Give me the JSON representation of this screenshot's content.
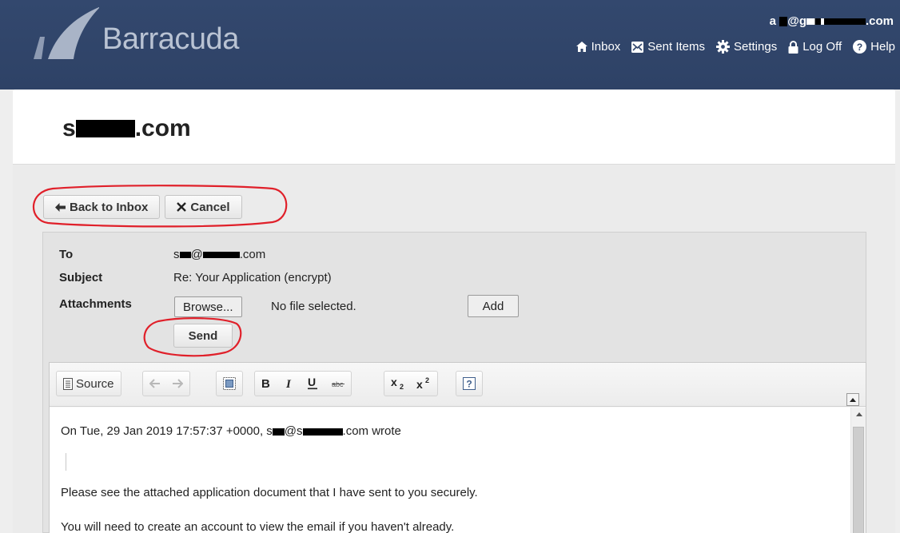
{
  "brand": {
    "name": "Barracuda"
  },
  "user": {
    "email_prefix": "a",
    "email_mid": "@g",
    "email_suffix": ".com"
  },
  "nav": {
    "inbox": "Inbox",
    "sent_items": "Sent Items",
    "settings": "Settings",
    "log_off": "Log Off",
    "help": "Help"
  },
  "page": {
    "title_prefix": "s",
    "title_suffix": ".com"
  },
  "actions": {
    "back_to_inbox": "Back to Inbox",
    "cancel": "Cancel"
  },
  "form": {
    "to_label": "To",
    "to_prefix": "s",
    "to_at": "@",
    "to_suffix": ".com",
    "subject_label": "Subject",
    "subject_value": "Re: Your Application (encrypt)",
    "attachments_label": "Attachments",
    "browse_label": "Browse...",
    "file_status": "No file selected.",
    "add_label": "Add",
    "send_label": "Send"
  },
  "editor": {
    "source_label": "Source",
    "subscript": "x",
    "superscript": "x",
    "help_label": "?",
    "quote_header_prefix": "On Tue, 29 Jan 2019 17:57:37 +0000, s",
    "quote_header_at": "@s",
    "quote_header_suffix": ".com wrote",
    "body_line_1": "Please see the attached application document that I have sent to you securely.",
    "body_line_2": "You will need to create an account to view the email if you haven't already."
  },
  "colors": {
    "header_bg": "#33486e",
    "annotation": "#e0202a",
    "logo": "#b9c3d3"
  }
}
